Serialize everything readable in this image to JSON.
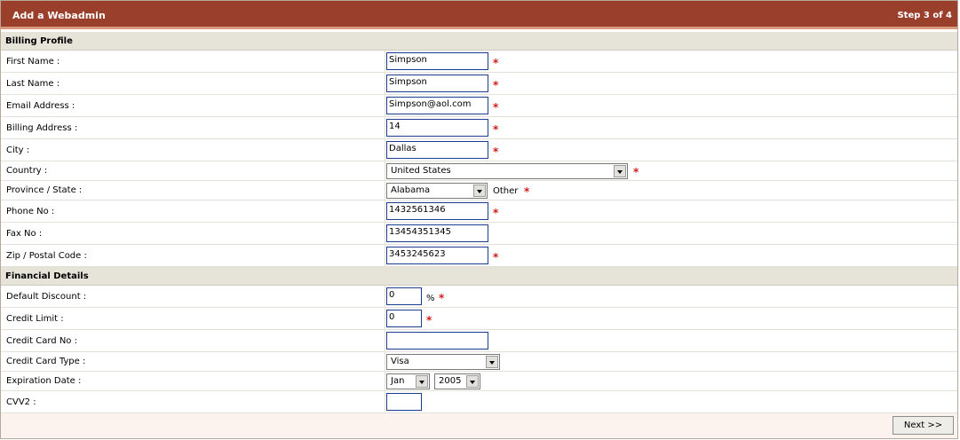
{
  "header": {
    "title": "Add a Webadmin",
    "step": "Step 3 of 4"
  },
  "billing": {
    "section_title": "Billing Profile",
    "first_name": {
      "label": "First Name :",
      "value": "Simpson"
    },
    "last_name": {
      "label": "Last Name :",
      "value": "Simpson"
    },
    "email": {
      "label": "Email Address :",
      "value": "Simpson@aol.com"
    },
    "address": {
      "label": "Billing Address :",
      "value": "14"
    },
    "city": {
      "label": "City :",
      "value": "Dallas"
    },
    "country": {
      "label": "Country :",
      "value": "United States"
    },
    "province": {
      "label": "Province / State :",
      "value": "Alabama",
      "other_label": "Other"
    },
    "phone": {
      "label": "Phone No :",
      "value": "1432561346"
    },
    "fax": {
      "label": "Fax No :",
      "value": "13454351345"
    },
    "zip": {
      "label": "Zip / Postal Code :",
      "value": "3453245623"
    }
  },
  "financial": {
    "section_title": "Financial Details",
    "discount": {
      "label": "Default Discount :",
      "value": "0",
      "unit": "%"
    },
    "credit_limit": {
      "label": "Credit Limit :",
      "value": "0"
    },
    "card_no": {
      "label": "Credit Card No :",
      "value": ""
    },
    "card_type": {
      "label": "Credit Card Type :",
      "value": "Visa"
    },
    "expiration": {
      "label": "Expiration Date :",
      "month": "Jan",
      "year": "2005"
    },
    "cvv2": {
      "label": "CVV2 :",
      "value": ""
    }
  },
  "required_marker": "*",
  "footer": {
    "next_label": "Next >>"
  },
  "colors": {
    "title_bar": "#9a3f2c",
    "section_bg": "#e6e3d8",
    "required": "#d21a1a",
    "input_border": "#1c3d8f"
  }
}
